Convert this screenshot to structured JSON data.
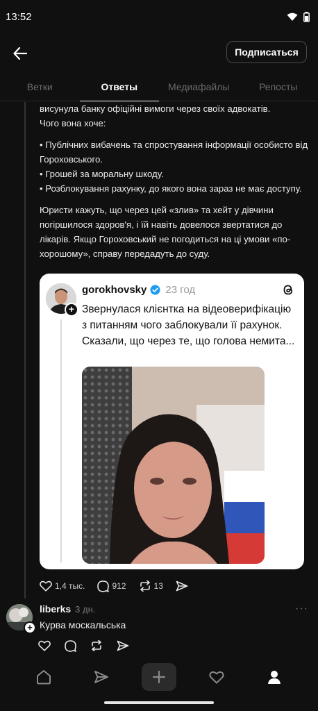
{
  "status_bar": {
    "time": "13:52"
  },
  "header": {
    "follow_label": "Подписаться"
  },
  "tabs": [
    {
      "label": "Ветки",
      "active": false
    },
    {
      "label": "Ответы",
      "active": true
    },
    {
      "label": "Медиафайлы",
      "active": false
    },
    {
      "label": "Репосты",
      "active": false
    }
  ],
  "post": {
    "lines": [
      "висунула банку офіційні вимоги через своїх адвокатів.",
      "Чого вона хоче:",
      "• Публічних вибачень та спростування інформації особисто від Гороховського.",
      "• Грошей за моральну шкоду.",
      "• Розблокування рахунку, до якого вона зараз не має доступу.",
      "Юристи кажуть, що через цей «злив» та хейт у дівчини погіршилося здоров'я, і їй навіть довелося звертатися до лікарів. Якщо Гороховський не погодиться на ці умови «по-хорошому», справу передадуть до суду."
    ],
    "quoted": {
      "username": "gorokhovsky",
      "time": "23 год",
      "text": "Звернулася клієнтка на відеоверифікацію з питанням чого заблокували її рахунок. Сказали, що через те, що голова немита..."
    },
    "actions": {
      "likes": "1,4 тыс.",
      "comments": "912",
      "reposts": "13"
    }
  },
  "reply": {
    "username": "liberks",
    "time": "3 дн.",
    "text": "Курва москальська",
    "more": "···"
  },
  "bottom_nav": [
    "home-icon",
    "search-icon",
    "create-icon",
    "activity-icon",
    "profile-icon"
  ],
  "colors": {
    "background": "#101010",
    "verified": "#1d9bf0",
    "card": "#ffffff"
  }
}
